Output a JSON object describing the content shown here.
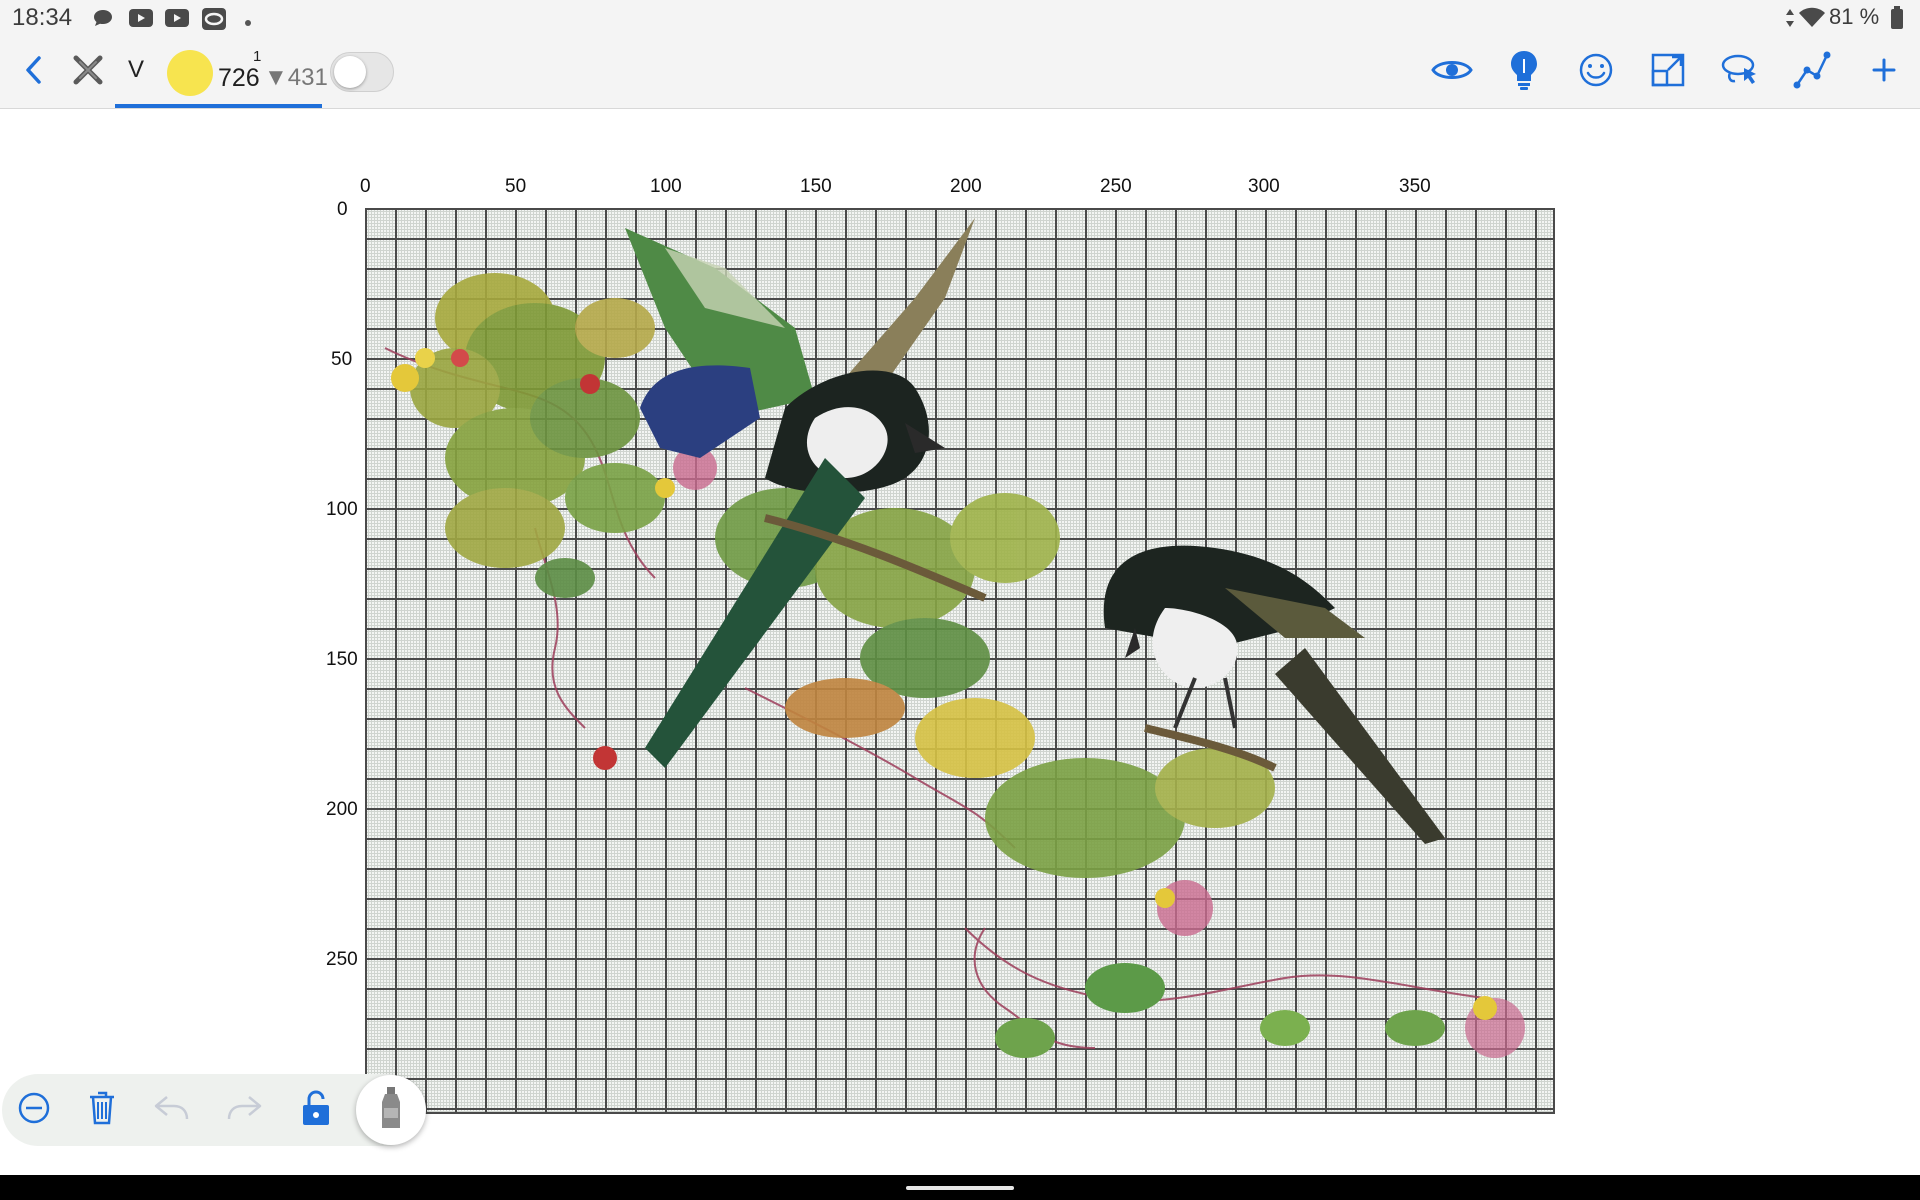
{
  "status_bar": {
    "time": "18:34",
    "left_icons": [
      "chat-bubble-icon",
      "youtube-icon",
      "youtube-icon",
      "app-icon",
      "dot-icon"
    ],
    "battery": "81 %",
    "right_icons": [
      "data-arrows-icon",
      "wifi-icon",
      "battery-icon"
    ]
  },
  "toolbar": {
    "back_icon": "chevron-left-icon",
    "close_icon": "close-icon",
    "symbol": "V",
    "color": "#f7e44f",
    "count_done": "726",
    "count_sup": "1",
    "count_remaining": "▼431",
    "toggle_on": false,
    "actions": [
      "eye-icon",
      "lightbulb-icon",
      "smiley-icon",
      "resize-icon",
      "lasso-icon",
      "path-icon",
      "plus-icon"
    ],
    "accent": "#1f6fd9"
  },
  "grid": {
    "x_ticks": [
      "0",
      "50",
      "100",
      "150",
      "200",
      "250",
      "300",
      "350"
    ],
    "y_ticks": [
      "0",
      "50",
      "100",
      "150",
      "200",
      "250"
    ]
  },
  "bottom_toolbar": {
    "actions": [
      "zoom-out-icon",
      "trash-icon",
      "undo-icon",
      "redo-icon",
      "lock-icon",
      "bottle-icon"
    ]
  }
}
